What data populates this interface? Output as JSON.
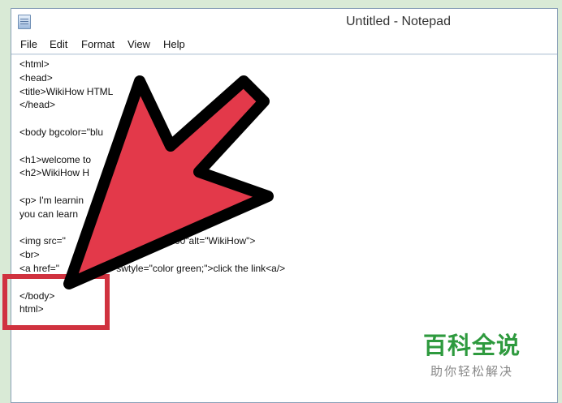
{
  "window": {
    "title": "Untitled - Notepad",
    "icon": "notepad-icon"
  },
  "menu": [
    {
      "label": "File"
    },
    {
      "label": "Edit"
    },
    {
      "label": "Format"
    },
    {
      "label": "View"
    },
    {
      "label": "Help"
    }
  ],
  "editor": {
    "lines": [
      "<html>",
      "<head>",
      "<title>WikiHow HTML",
      "</head>",
      "",
      "<body bgcolor=\"blu",
      "",
      "<h1>welcome to",
      "<h2>WikiHow H",
      "",
      "<p> I'm learnin                                     les! <br>",
      "you can learn",
      "",
      "<img src=\"                    00 height=\"200\"alt=\"WikiHow\">",
      "<br>",
      "<a href=\"               ml\" swtyle=\"color green;\">click the link<a/>",
      "",
      "</body>",
      "html>"
    ]
  },
  "annotation": {
    "arrow_color": "#e3394a",
    "arrow_outline": "#000000",
    "highlight_color": "#d0323f"
  },
  "watermark": {
    "logo": "百科全说",
    "tagline": "助你轻松解决",
    "logo_color": "#2e9a3e"
  }
}
